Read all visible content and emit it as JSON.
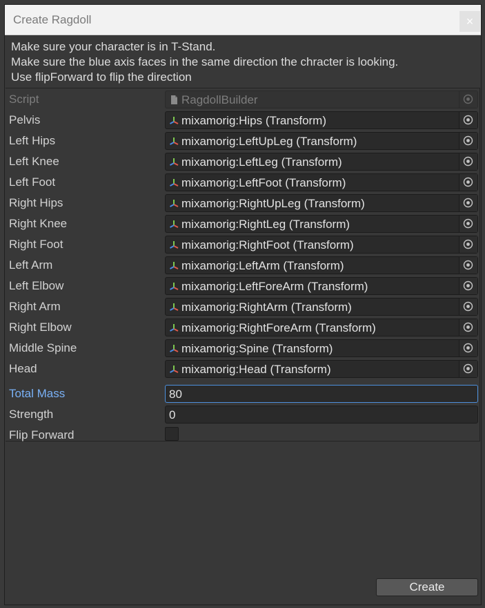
{
  "window": {
    "title": "Create Ragdoll",
    "close_label": "×"
  },
  "help": {
    "line1": "Make sure your character is in T-Stand.",
    "line2": "Make sure the blue axis faces in the same direction the chracter is looking.",
    "line3": "Use flipForward to flip the direction"
  },
  "script": {
    "label": "Script",
    "value": "RagdollBuilder"
  },
  "bones": [
    {
      "label": "Pelvis",
      "value": "mixamorig:Hips (Transform)"
    },
    {
      "label": "Left Hips",
      "value": "mixamorig:LeftUpLeg (Transform)"
    },
    {
      "label": "Left Knee",
      "value": "mixamorig:LeftLeg (Transform)"
    },
    {
      "label": "Left Foot",
      "value": "mixamorig:LeftFoot (Transform)"
    },
    {
      "label": "Right Hips",
      "value": "mixamorig:RightUpLeg (Transform)"
    },
    {
      "label": "Right Knee",
      "value": "mixamorig:RightLeg (Transform)"
    },
    {
      "label": "Right Foot",
      "value": "mixamorig:RightFoot (Transform)"
    },
    {
      "label": "Left Arm",
      "value": "mixamorig:LeftArm (Transform)"
    },
    {
      "label": "Left Elbow",
      "value": "mixamorig:LeftForeArm (Transform)"
    },
    {
      "label": "Right Arm",
      "value": "mixamorig:RightArm (Transform)"
    },
    {
      "label": "Right Elbow",
      "value": "mixamorig:RightForeArm (Transform)"
    },
    {
      "label": "Middle Spine",
      "value": "mixamorig:Spine (Transform)"
    },
    {
      "label": "Head",
      "value": "mixamorig:Head (Transform)"
    }
  ],
  "total_mass": {
    "label": "Total Mass",
    "value": "80"
  },
  "strength": {
    "label": "Strength",
    "value": "0"
  },
  "flip_forward": {
    "label": "Flip Forward",
    "checked": false
  },
  "create_label": "Create",
  "colors": {
    "focus_label": "#79b0f5",
    "focus_border": "#4d90dd",
    "background": "#383838"
  },
  "icons": {
    "transform": "transform-axis-icon",
    "script": "script-file-icon",
    "picker": "object-picker-icon"
  }
}
